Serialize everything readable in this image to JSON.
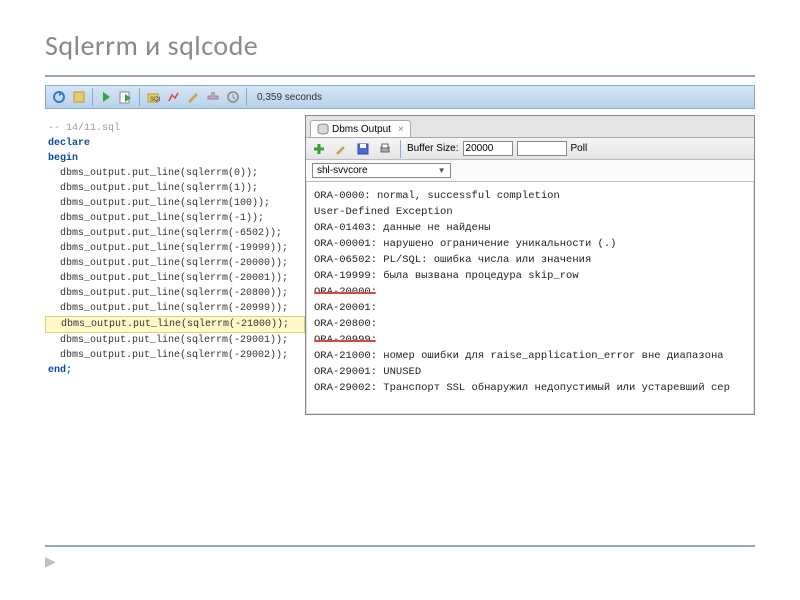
{
  "title_a": "Sqlerrm ",
  "title_b": "и",
  "title_c": " sqlcode",
  "toolbar": {
    "time": "0,359 seconds"
  },
  "code": {
    "comment": "-- 14/11.sql",
    "declare": "declare",
    "begin": "begin",
    "lines": [
      "  dbms_output.put_line(sqlerrm(0));",
      "  dbms_output.put_line(sqlerrm(1));",
      "  dbms_output.put_line(sqlerrm(100));",
      "  dbms_output.put_line(sqlerrm(-1));",
      "  dbms_output.put_line(sqlerrm(-6502));",
      "  dbms_output.put_line(sqlerrm(-19999));",
      "  dbms_output.put_line(sqlerrm(-20000));",
      "  dbms_output.put_line(sqlerrm(-20001));",
      "  dbms_output.put_line(sqlerrm(-20800));",
      "  dbms_output.put_line(sqlerrm(-20999));",
      "  dbms_output.put_line(sqlerrm(-21000));",
      "  dbms_output.put_line(sqlerrm(-29001));",
      "  dbms_output.put_line(sqlerrm(-29002));"
    ],
    "highlighted_index": 10,
    "end": "end;"
  },
  "dbms": {
    "tab_label": "Dbms Output",
    "buffer_label": "Buffer Size:",
    "buffer_value": "20000",
    "poll_label": "Poll",
    "connection": "shl-svvcore",
    "lines": [
      "ORA-0000: normal, successful completion",
      "User-Defined Exception",
      "ORA-01403: данные не найдены",
      "ORA-00001: нарушено ограничение уникальности (.)",
      "ORA-06502: PL/SQL:  ошибка числа или значения",
      "ORA-19999: была вызвана процедура skip_row",
      "ORA-20000:",
      "ORA-20001:",
      "ORA-20800:",
      "ORA-20999:",
      "ORA-21000: номер ошибки для raise_application_error  вне диапазона",
      "ORA-29001: UNUSED",
      "ORA-29002: Транспорт SSL обнаружил недопустимый или устаревший сер"
    ]
  }
}
